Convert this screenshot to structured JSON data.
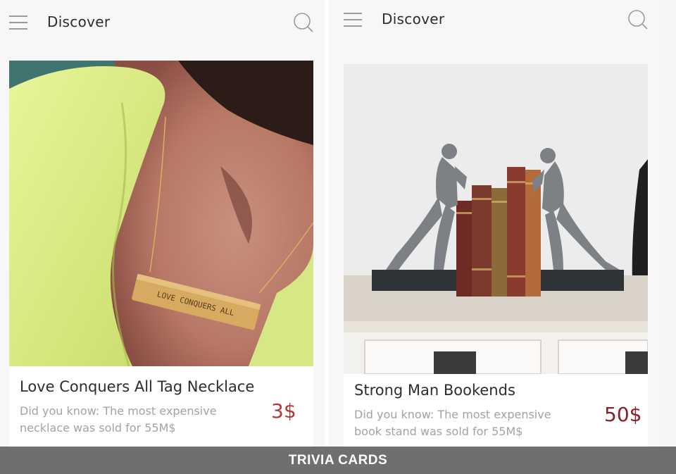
{
  "screens": [
    {
      "header_title": "Discover",
      "card": {
        "title": "Love Conquers All Tag Necklace",
        "trivia": "Did you know: The most expensive\nnecklace was sold for 55M$",
        "price": "3$",
        "price_color": "#b03a3a",
        "engraving": "LOVE CONQUERS ALL"
      }
    },
    {
      "header_title": "Discover",
      "card": {
        "title": "Strong Man Bookends",
        "trivia": "Did you know: The most expensive\nbook stand was sold for 55M$",
        "price": "50$",
        "price_color": "#8c1d2a"
      }
    }
  ],
  "banner": {
    "label": "TRIVIA CARDS",
    "background": "#6f6f71"
  },
  "icons": {
    "menu": "hamburger-menu-icon",
    "search": "search-icon"
  }
}
